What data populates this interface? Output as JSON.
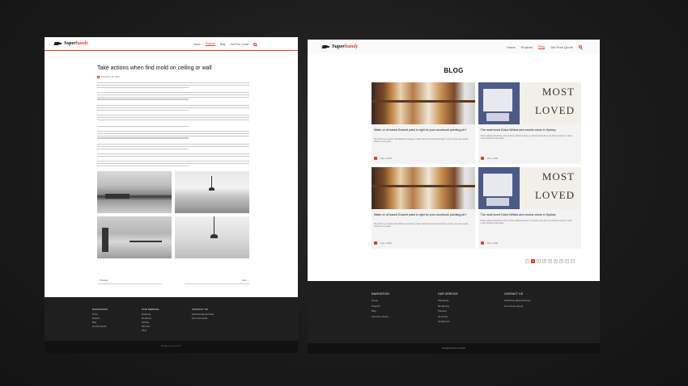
{
  "left_page": {
    "logo": "Superhandy",
    "nav": [
      "Home",
      "Projects",
      "Blog",
      "Get Free Quote"
    ],
    "active_nav": 1,
    "article": {
      "title": "Take actions when find mold on ceiling or wall",
      "date": "November 26, 2021"
    },
    "post_nav": {
      "prev": "← Previous",
      "next": "Next →"
    },
    "footer": {
      "col1_title": "NAVIGATION",
      "col1": [
        "Home",
        "Projects",
        "Blog",
        "Get Free Quote"
      ],
      "col2_title": "OUR SERVICE",
      "col2": [
        "Plastering",
        "Rendering",
        "Painting",
        "Removal",
        "Tiling"
      ],
      "col3_title": "CONTACT US",
      "col3": [
        "Facebook @superhandy",
        "Get a Free Quote"
      ],
      "copyright": "All Rights Reserved 2021"
    }
  },
  "right_page": {
    "logo": "Superhandy",
    "nav": [
      "Home",
      "Projects",
      "Blog",
      "Get Free Quote"
    ],
    "active_nav": 2,
    "blog_title": "BLOG",
    "cards": [
      {
        "image": "window-frame-photo",
        "title": "Water or oil based Enamel paint is right for your woodwork painting job?",
        "excerpt": "We will let you what's the difference between water based and oil based paint, and so you can exactly which one to paint.",
        "date": "July 1, 2021"
      },
      {
        "image": "most-loved-photo",
        "title": "The most loved Dulux Whites and neutral colors in Sydney",
        "excerpt": "Dulux whites should be a list of their preferred base or natural tones from the Dulux brochure. Most Loved Whites & Neutrals.",
        "date": "July 1, 2021"
      },
      {
        "image": "window-frame-photo",
        "title": "Water or oil based Enamel paint is right for your woodwork painting job?",
        "excerpt": "We will let you what's the difference between water based and oil based paint, and so you can exactly which one to paint.",
        "date": "July 1, 2021"
      },
      {
        "image": "most-loved-photo",
        "title": "The most loved Dulux Whites and neutral colors in Sydney",
        "excerpt": "Dulux whites should be a list of their preferred base or natural tones from the Dulux brochure. Most Loved Whites & Neutrals.",
        "date": "July 1, 2021"
      }
    ],
    "pagination": [
      "<",
      "1",
      "2",
      "3",
      "4",
      "5",
      "6",
      "7",
      ">"
    ],
    "active_page": 1,
    "footer": {
      "col1_title": "NAVIGATION",
      "col1": [
        "Home",
        "Projects",
        "Blog",
        "Get Free Quote"
      ],
      "col2_title": "OUR SERVICE",
      "col2": [
        "Plastering",
        "Rendering",
        "Painting",
        "Removal",
        "Handyman"
      ],
      "col3_title": "CONTACT US",
      "col3": [
        "Facebook @superhandy",
        "Get a Free Quote"
      ],
      "copyright": "All Rights Reserved 2021"
    }
  },
  "colors": {
    "accent": "#e53b2c",
    "footer": "#1f1f1f",
    "backdrop": "#1a1a1a"
  }
}
